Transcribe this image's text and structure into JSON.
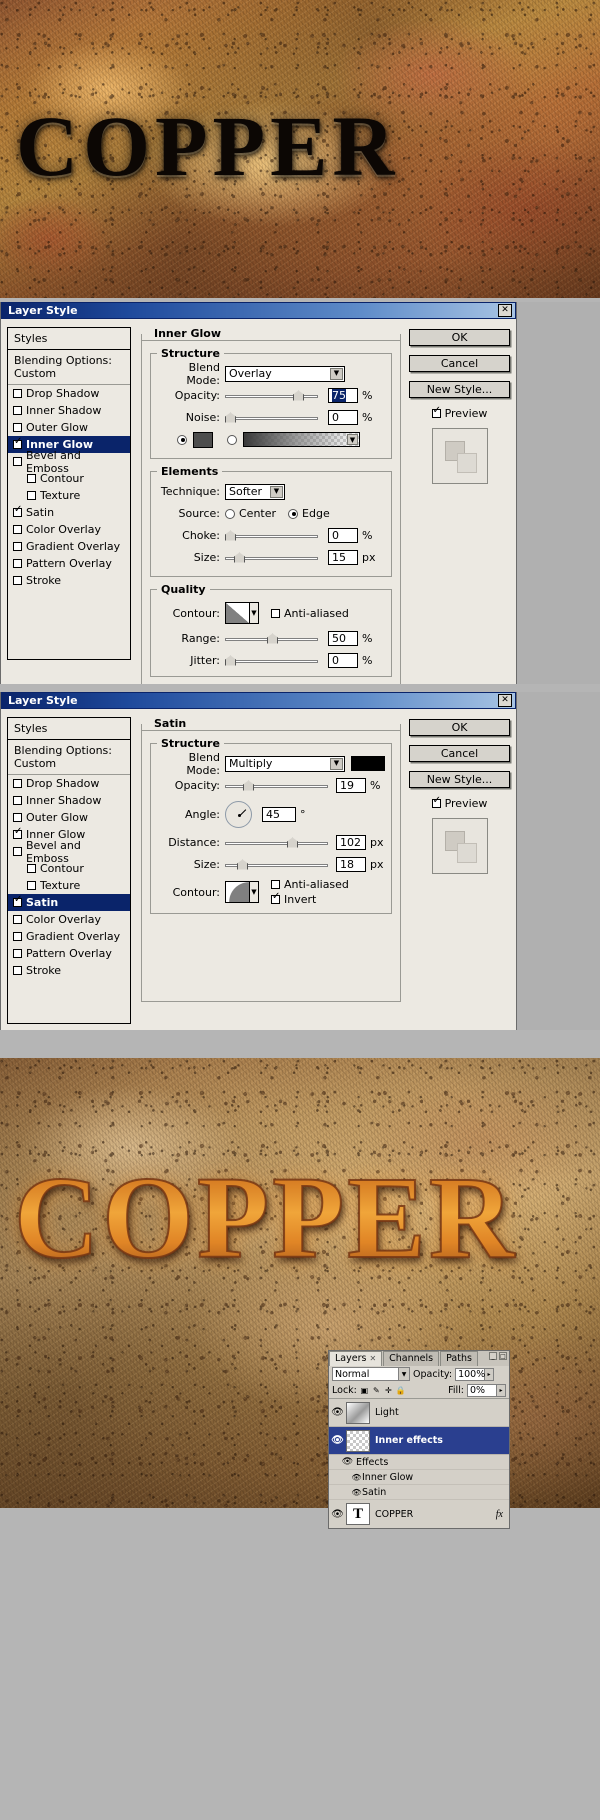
{
  "artwork": {
    "top_text": "COPPER",
    "bottom_text": "COPPER",
    "palette": {
      "copper": "#c8701e",
      "rust": "#8a5a28",
      "highlight": "#f0a53a"
    }
  },
  "dialog_inner_glow": {
    "title": "Layer Style",
    "close_label": "✕",
    "styles_panel": {
      "header": "Styles",
      "blending_options": "Blending Options: Custom",
      "items": [
        {
          "label": "Drop Shadow",
          "checked": false,
          "selected": false,
          "indent": false
        },
        {
          "label": "Inner Shadow",
          "checked": false,
          "selected": false,
          "indent": false
        },
        {
          "label": "Outer Glow",
          "checked": false,
          "selected": false,
          "indent": false
        },
        {
          "label": "Inner Glow",
          "checked": true,
          "selected": true,
          "indent": false
        },
        {
          "label": "Bevel and Emboss",
          "checked": false,
          "selected": false,
          "indent": false
        },
        {
          "label": "Contour",
          "checked": false,
          "selected": false,
          "indent": true
        },
        {
          "label": "Texture",
          "checked": false,
          "selected": false,
          "indent": true
        },
        {
          "label": "Satin",
          "checked": true,
          "selected": false,
          "indent": false
        },
        {
          "label": "Color Overlay",
          "checked": false,
          "selected": false,
          "indent": false
        },
        {
          "label": "Gradient Overlay",
          "checked": false,
          "selected": false,
          "indent": false
        },
        {
          "label": "Pattern Overlay",
          "checked": false,
          "selected": false,
          "indent": false
        },
        {
          "label": "Stroke",
          "checked": false,
          "selected": false,
          "indent": false
        }
      ]
    },
    "section_title": "Inner Glow",
    "structure": {
      "legend": "Structure",
      "blend_mode_label": "Blend Mode:",
      "blend_mode_value": "Overlay",
      "opacity_label": "Opacity:",
      "opacity_value": "75",
      "opacity_unit": "%",
      "noise_label": "Noise:",
      "noise_value": "0",
      "noise_unit": "%",
      "color_selected": true,
      "gradient_selected": false,
      "color_swatch": "#4d4d4d"
    },
    "elements": {
      "legend": "Elements",
      "technique_label": "Technique:",
      "technique_value": "Softer",
      "source_label": "Source:",
      "source_center": "Center",
      "source_edge": "Edge",
      "source_selected": "Edge",
      "choke_label": "Choke:",
      "choke_value": "0",
      "choke_unit": "%",
      "size_label": "Size:",
      "size_value": "15",
      "size_unit": "px"
    },
    "quality": {
      "legend": "Quality",
      "contour_label": "Contour:",
      "antialiased_label": "Anti-aliased",
      "antialiased_checked": false,
      "range_label": "Range:",
      "range_value": "50",
      "range_unit": "%",
      "jitter_label": "Jitter:",
      "jitter_value": "0",
      "jitter_unit": "%"
    },
    "buttons": {
      "ok": "OK",
      "cancel": "Cancel",
      "new_style": "New Style...",
      "preview": "Preview",
      "preview_checked": true
    }
  },
  "dialog_satin": {
    "title": "Layer Style",
    "close_label": "✕",
    "styles_panel": {
      "header": "Styles",
      "blending_options": "Blending Options: Custom",
      "items": [
        {
          "label": "Drop Shadow",
          "checked": false,
          "selected": false,
          "indent": false
        },
        {
          "label": "Inner Shadow",
          "checked": false,
          "selected": false,
          "indent": false
        },
        {
          "label": "Outer Glow",
          "checked": false,
          "selected": false,
          "indent": false
        },
        {
          "label": "Inner Glow",
          "checked": true,
          "selected": false,
          "indent": false
        },
        {
          "label": "Bevel and Emboss",
          "checked": false,
          "selected": false,
          "indent": false
        },
        {
          "label": "Contour",
          "checked": false,
          "selected": false,
          "indent": true
        },
        {
          "label": "Texture",
          "checked": false,
          "selected": false,
          "indent": true
        },
        {
          "label": "Satin",
          "checked": true,
          "selected": true,
          "indent": false
        },
        {
          "label": "Color Overlay",
          "checked": false,
          "selected": false,
          "indent": false
        },
        {
          "label": "Gradient Overlay",
          "checked": false,
          "selected": false,
          "indent": false
        },
        {
          "label": "Pattern Overlay",
          "checked": false,
          "selected": false,
          "indent": false
        },
        {
          "label": "Stroke",
          "checked": false,
          "selected": false,
          "indent": false
        }
      ]
    },
    "section_title": "Satin",
    "structure": {
      "legend": "Structure",
      "blend_mode_label": "Blend Mode:",
      "blend_mode_value": "Multiply",
      "color_swatch": "#000000",
      "opacity_label": "Opacity:",
      "opacity_value": "19",
      "opacity_unit": "%",
      "angle_label": "Angle:",
      "angle_value": "45",
      "angle_unit": "°",
      "distance_label": "Distance:",
      "distance_value": "102",
      "distance_unit": "px",
      "size_label": "Size:",
      "size_value": "18",
      "size_unit": "px",
      "contour_label": "Contour:",
      "antialiased_label": "Anti-aliased",
      "antialiased_checked": false,
      "invert_label": "Invert",
      "invert_checked": true
    },
    "buttons": {
      "ok": "OK",
      "cancel": "Cancel",
      "new_style": "New Style...",
      "preview": "Preview",
      "preview_checked": true
    }
  },
  "layers_panel": {
    "tabs": [
      {
        "label": "Layers",
        "active": true,
        "closable": true
      },
      {
        "label": "Channels",
        "active": false,
        "closable": false
      },
      {
        "label": "Paths",
        "active": false,
        "closable": false
      }
    ],
    "blend_mode": "Normal",
    "opacity_label": "Opacity:",
    "opacity_value": "100%",
    "lock_label": "Lock:",
    "lock_icons": [
      "transparency-lock",
      "pixels-lock",
      "position-lock",
      "all-lock"
    ],
    "fill_label": "Fill:",
    "fill_value": "0%",
    "layers": [
      {
        "name": "Light",
        "visible": true,
        "selected": false,
        "thumb": "gradient",
        "fx": ""
      },
      {
        "name": "Inner effects",
        "visible": true,
        "selected": true,
        "thumb": "checker",
        "fx": ""
      }
    ],
    "effects_group": {
      "label": "Effects",
      "items": [
        "Inner Glow",
        "Satin"
      ]
    },
    "text_layer": {
      "name": "COPPER",
      "visible": true,
      "thumb_letter": "T",
      "fx": "fx"
    }
  }
}
